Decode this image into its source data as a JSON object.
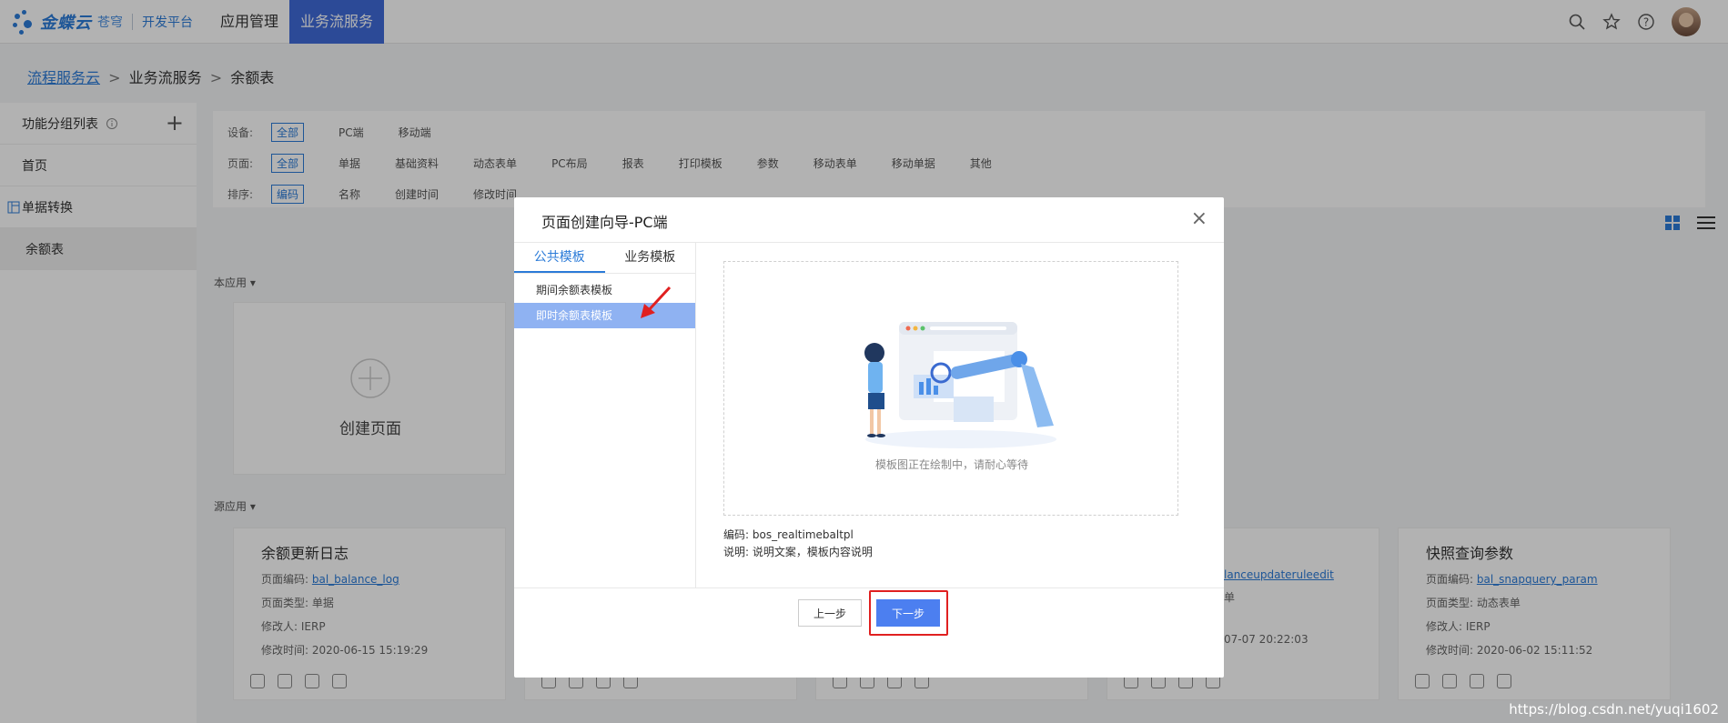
{
  "topbar": {
    "brand": "金蝶云",
    "brand_sub": "苍穹",
    "platform": "开发平台",
    "nav": [
      "应用管理",
      "业务流服务"
    ],
    "icons": [
      "search-icon",
      "star-icon",
      "help-icon",
      "user-avatar"
    ]
  },
  "breadcrumb": {
    "root": "流程服务云",
    "mid": "业务流服务",
    "current": "余额表",
    "sep": ">"
  },
  "sidebar": {
    "header": "功能分组列表",
    "items": [
      "首页",
      "单据转换",
      "余额表"
    ]
  },
  "filters": {
    "device_label": "设备:",
    "device_opts": [
      "全部",
      "PC端",
      "移动端"
    ],
    "page_label": "页面:",
    "page_opts": [
      "全部",
      "单据",
      "基础资料",
      "动态表单",
      "PC布局",
      "报表",
      "打印模板",
      "参数",
      "移动表单",
      "移动单据",
      "其他"
    ],
    "sort_label": "排序:",
    "sort_opts": [
      "编码",
      "名称",
      "创建时间",
      "修改时间"
    ]
  },
  "sections": {
    "this_app": "本应用",
    "source_app": "源应用",
    "create_page": "创建页面"
  },
  "cards": [
    {
      "title": "余额更新日志",
      "code_label": "页面编码:",
      "code": "bal_balance_log",
      "type": "页面类型: 单据",
      "modifier": "修改人: IERP",
      "time": "修改时间: 2020-06-15 15:19:29"
    },
    {
      "code_partial": "lanceupdateruleedit",
      "type_partial": "单",
      "time_partial": "07-07 20:22:03"
    },
    {
      "title": "快照查询参数",
      "code_label": "页面编码:",
      "code": "bal_snapquery_param",
      "type": "页面类型: 动态表单",
      "modifier": "修改人: IERP",
      "time": "修改时间: 2020-06-02 15:11:52"
    }
  ],
  "dialog": {
    "title": "页面创建向导-PC端",
    "close": "×",
    "tabs": [
      "公共模板",
      "业务模板"
    ],
    "templates": [
      "期间余额表模板",
      "即时余额表模板"
    ],
    "preview_text": "模板图正在绘制中，请耐心等待",
    "code": "编码: bos_realtimebaltpl",
    "desc": "说明: 说明文案，模板内容说明",
    "btn_prev": "上一步",
    "btn_next": "下一步"
  },
  "watermark": "https://blog.csdn.net/yuqi1602",
  "colors": {
    "accent": "#2b7bd8",
    "primary_button": "#4c7ff0",
    "highlight": "#e02020",
    "selected_item": "#8fb2f2"
  }
}
